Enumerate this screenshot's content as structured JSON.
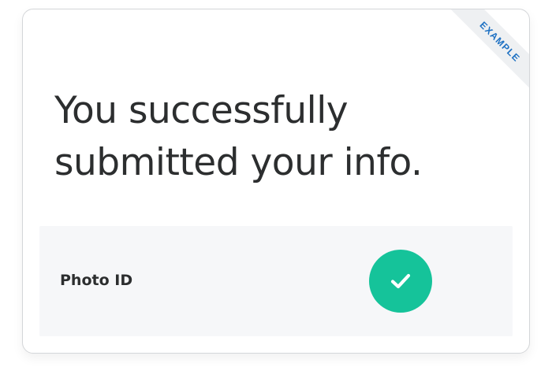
{
  "ribbon": {
    "label": "EXAMPLE",
    "color": "#1d70c2"
  },
  "headline": {
    "line1": "You successfully",
    "line2": "submitted your info."
  },
  "status": {
    "item_label": "Photo ID",
    "state_icon": "checkmark-icon",
    "state_color": "#15c39a"
  }
}
